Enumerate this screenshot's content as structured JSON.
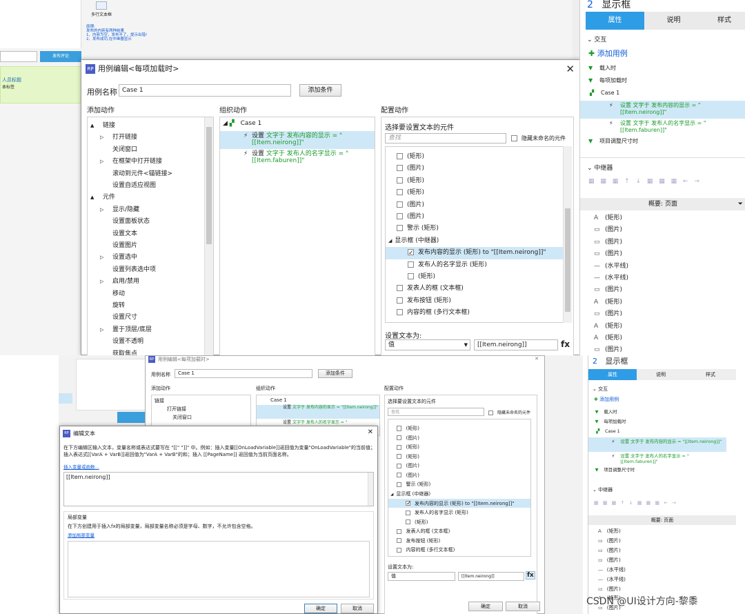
{
  "top": {
    "dialog_title": "用例编辑<每项加载时>",
    "case_name_label": "用例名称",
    "case_name_value": "Case 1",
    "add_condition": "添加条件",
    "col_add_action": "添加动作",
    "col_organize": "组织动作",
    "col_configure": "配置动作",
    "action_tree": [
      {
        "label": "链接",
        "level": 0,
        "expander": "▲"
      },
      {
        "label": "打开链接",
        "level": 1,
        "expander": "▷"
      },
      {
        "label": "关闭窗口",
        "level": 1,
        "expander": ""
      },
      {
        "label": "在框架中打开链接",
        "level": 1,
        "expander": "▷"
      },
      {
        "label": "滚动到元件<锚链接>",
        "level": 1,
        "expander": ""
      },
      {
        "label": "设置自适应视图",
        "level": 1,
        "expander": ""
      },
      {
        "label": "元件",
        "level": 0,
        "expander": "▲"
      },
      {
        "label": "显示/隐藏",
        "level": 1,
        "expander": "▷"
      },
      {
        "label": "设置面板状态",
        "level": 1,
        "expander": ""
      },
      {
        "label": "设置文本",
        "level": 1,
        "expander": ""
      },
      {
        "label": "设置图片",
        "level": 1,
        "expander": ""
      },
      {
        "label": "设置选中",
        "level": 1,
        "expander": "▷"
      },
      {
        "label": "设置列表选中项",
        "level": 1,
        "expander": ""
      },
      {
        "label": "启用/禁用",
        "level": 1,
        "expander": "▷"
      },
      {
        "label": "移动",
        "level": 1,
        "expander": ""
      },
      {
        "label": "旋转",
        "level": 1,
        "expander": ""
      },
      {
        "label": "设置尺寸",
        "level": 1,
        "expander": ""
      },
      {
        "label": "置于顶层/底层",
        "level": 1,
        "expander": "▷"
      },
      {
        "label": "设置不透明",
        "level": 1,
        "expander": ""
      },
      {
        "label": "获取焦点",
        "level": 1,
        "expander": ""
      }
    ],
    "case_label": "Case 1",
    "organized": [
      {
        "prefix": "设置",
        "text": "文字于 发布内容的显示 = \"[[Item.neirong]]\""
      },
      {
        "prefix": "设置",
        "text": "文字于 发布人的名字显示 = \"[[Item.faburen]]\""
      }
    ],
    "choose_widget": "选择要设置文本的元件",
    "search_placeholder": "查找",
    "hide_unnamed": "隐藏未命名的元件",
    "widgets": [
      {
        "label": "(矩形)",
        "level": 1,
        "checked": false
      },
      {
        "label": "(图片)",
        "level": 1,
        "checked": false
      },
      {
        "label": "(矩形)",
        "level": 1,
        "checked": false
      },
      {
        "label": "(矩形)",
        "level": 1,
        "checked": false
      },
      {
        "label": "(图片)",
        "level": 1,
        "checked": false
      },
      {
        "label": "(图片)",
        "level": 1,
        "checked": false
      },
      {
        "label": "警示 (矩形)",
        "level": 1,
        "checked": false
      },
      {
        "label": "显示框 (中继器)",
        "level": 0,
        "checked": null
      },
      {
        "label": "发布内容的显示 (矩形) to \"[[Item.neirong]]\"",
        "level": 2,
        "checked": true
      },
      {
        "label": "发布人的名字显示 (矩形)",
        "level": 2,
        "checked": false
      },
      {
        "label": "(矩形)",
        "level": 2,
        "checked": false
      },
      {
        "label": "发表人的框 (文本框)",
        "level": 1,
        "checked": false
      },
      {
        "label": "发布按钮 (矩形)",
        "level": 1,
        "checked": false
      },
      {
        "label": "内容的框 (多行文本框)",
        "level": 1,
        "checked": false
      }
    ],
    "set_text_to": "设置文本为:",
    "value_type": "值",
    "value_text": "[[Item.neirong]]",
    "fx": "fx"
  },
  "right_top": {
    "title_num": "2",
    "title": "显示框",
    "tabs": [
      "属性",
      "说明",
      "样式"
    ],
    "interact": "交互",
    "add_case": "添加用例",
    "events": [
      {
        "label": "载入时",
        "level": 0
      },
      {
        "label": "每项加载时",
        "level": 0
      },
      {
        "label": "Case 1",
        "level": 1
      },
      {
        "label": "设置 文字于 发布内容的显示 = \"[[Item.neirong]]\"",
        "level": 2,
        "hl": true
      },
      {
        "label": "设置 文字于 发布人的名字显示 = \"[[Item.faburen]]\"",
        "level": 2,
        "hl": false
      },
      {
        "label": "项目调整尺寸时",
        "level": 0
      }
    ],
    "repeater": "中继器",
    "outline_tabs": "概要: 页面",
    "outline": [
      {
        "icon": "A",
        "label": "(矩形)"
      },
      {
        "icon": "▭",
        "label": "(图片)"
      },
      {
        "icon": "▭",
        "label": "(图片)"
      },
      {
        "icon": "▭",
        "label": "(图片)"
      },
      {
        "icon": "—",
        "label": "(水平线)"
      },
      {
        "icon": "—",
        "label": "(水平线)"
      },
      {
        "icon": "▭",
        "label": "(图片)"
      },
      {
        "icon": "A",
        "label": "(矩形)"
      },
      {
        "icon": "▭",
        "label": "(图片)"
      },
      {
        "icon": "A",
        "label": "(矩形)"
      },
      {
        "icon": "A",
        "label": "(矩形)"
      },
      {
        "icon": "▭",
        "label": "(图片)"
      }
    ]
  },
  "bg_top": {
    "widget_label": "多行文本框",
    "notes": [
      "原理:",
      "发布的内容有两种结果",
      "1、内容为空，发布不了，提示出错!",
      "2、发布成功,在中继器显示"
    ],
    "publish_btn": "发布评论",
    "green_title": "人员标题",
    "green_sub": "本标签"
  },
  "bottom": {
    "edit_title": "编辑文本",
    "desc": "在下方编辑区输入文本，变量名称或表达式要写在 \"[[\" \"]]\" 中。例如：插入变量[[OnLoadVariable]]返回值为变量\"OnLoadVariable\"的当前值；插入表达式[[VarA + VarB]]返回值为\"VarA + VarB\"的和；插入 [[PageName]] 返回值为当前页面名称。",
    "insert_link": "插入变量或函数...",
    "editor_value": "[[Item.neirong]]",
    "local_vars": "局部变量",
    "local_desc": "在下方创建用于插入fx的局部变量，局部变量名称必须是字母、数字，不允许包含空格。",
    "add_local": "添加局部变量",
    "ok": "确定",
    "cancel": "取消",
    "bg_dialog_title": "用例编辑<每项加载时>",
    "ok2": "确定",
    "cancel2": "取消",
    "watermark": "CSDN @UI设计方向-黎黍"
  }
}
